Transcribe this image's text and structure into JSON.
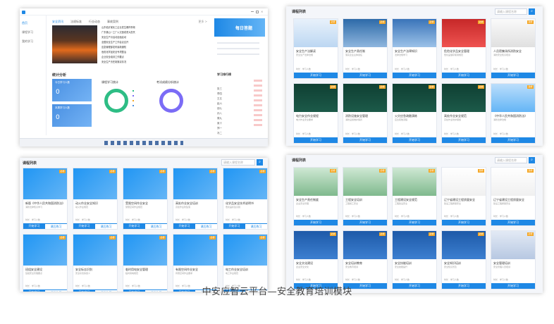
{
  "caption": "中安应智云平台—安全教育培训模块",
  "dashboard": {
    "sidebar": [
      "首页",
      "课程学习",
      "我的学习"
    ],
    "news_tabs": [
      "安全资讯",
      "法规标准",
      "行业动态",
      "事故案例"
    ],
    "more": "更多 >",
    "news_items": [
      "山东临沂某化工企业发生爆炸事故",
      "广东佛山一工厂火灾造成重大损失",
      "安全生产月活动全面启动",
      "全国安全生产工作会议召开",
      "应急管理部发布最新通知",
      "危险化学品安全专项整治",
      "企业安全培训工作要点",
      "安全生产责任制落实情况"
    ],
    "banner": "每日答题",
    "rank_title": "学习排行榜",
    "stats_title": "统计分析",
    "stat_tiles": [
      {
        "label": "今日学习人数",
        "value": "0"
      },
      {
        "label": "本周学习人数",
        "value": "0"
      }
    ],
    "donut1_title": "课程学习统计",
    "donut2_title": "考试成绩分析统计",
    "rank_list": [
      "张三",
      "李四",
      "王五",
      "赵六",
      "钱七",
      "孙八",
      "周九",
      "吴十",
      "郑一",
      "冯二"
    ],
    "bottom_card": "课程学习人数"
  },
  "panel_common": {
    "title": "课程列表",
    "search_placeholder": "请输入课程名称",
    "search_icon": "search-icon",
    "btn_start": "开始学习",
    "btn_review": "课后练习",
    "meta": "时长 · 学习人数"
  },
  "tr_cards": [
    {
      "name": "安全生产法解读",
      "desc": "安全生产法律法规",
      "badge": "必修"
    },
    {
      "name": "安全生产责任制",
      "desc": "落实企业主体责任",
      "badge": "必修"
    },
    {
      "name": "安全生产法律知识",
      "desc": "法律法规学习",
      "badge": "必修"
    },
    {
      "name": "危险化学品安全管理",
      "desc": "危化品储存使用规范",
      "badge": "必修"
    },
    {
      "name": "人员密集场所消防安全",
      "desc": "消防安全知识培训",
      "badge": "选修"
    },
    {
      "name": "电力安全作业规程",
      "desc": "电力作业安全要求",
      "badge": "必修"
    },
    {
      "name": "消防设施安全管理",
      "desc": "消防设施维护保养",
      "badge": "必修"
    },
    {
      "name": "火灾应急疏散演练",
      "desc": "应急疏散流程",
      "badge": "必修"
    },
    {
      "name": "高处作业安全规范",
      "desc": "高处作业防护措施",
      "badge": "必修"
    },
    {
      "name": "《中华人民共和国消防法》",
      "desc": "消防法律法规",
      "badge": "选修"
    }
  ],
  "bl_cards": [
    {
      "name": "新版《中华人民共和国消防法》",
      "desc": "消防法律知识学习",
      "badge": "必修"
    },
    {
      "name": "动火作业安全知识",
      "desc": "动火作业规范",
      "badge": "必修"
    },
    {
      "name": "受限空间作业安全",
      "desc": "受限空间作业规范",
      "badge": "必修"
    },
    {
      "name": "高处作业安全培训",
      "desc": "高处作业防坠落",
      "badge": "必修"
    },
    {
      "name": "化学品安全技术说明书",
      "desc": "危化品标签识别",
      "badge": "必修"
    },
    {
      "name": "班组安全建设",
      "desc": "班组安全管理要点",
      "badge": "必修"
    },
    {
      "name": "安全标志识别",
      "desc": "安全标志的含义",
      "badge": "必修"
    },
    {
      "name": "临时用电安全管理",
      "desc": "临时用电规范",
      "badge": "必修"
    },
    {
      "name": "有限空间作业安全",
      "desc": "有限空间作业要求",
      "badge": "必修"
    },
    {
      "name": "电工作业安全培训",
      "desc": "电工作业规范",
      "badge": "必修"
    }
  ],
  "br_cards": [
    {
      "name": "安全生产责任制度",
      "desc": "企业安全管理",
      "badge": "必修"
    },
    {
      "name": "工程安全培训",
      "desc": "工程施工安全",
      "badge": "必修"
    },
    {
      "name": "工程建设安全规范",
      "desc": "工程建设安全",
      "badge": "必修"
    },
    {
      "name": "辽宁省建设工程质量安全",
      "desc": "建设工程质量安全",
      "badge": "选修"
    },
    {
      "name": "辽宁省建设工程质量安全",
      "desc": "建设工程质量安全",
      "badge": "选修"
    },
    {
      "name": "安全文化建设",
      "desc": "企业安全文化",
      "badge": "必修"
    },
    {
      "name": "安全培训教育",
      "desc": "安全教育培训",
      "badge": "必修"
    },
    {
      "name": "安全技能培训",
      "desc": "安全技能提升",
      "badge": "必修"
    },
    {
      "name": "安全知识培训",
      "desc": "安全知识普及",
      "badge": "必修"
    },
    {
      "name": "安全管理培训",
      "desc": "安全管理人员培训",
      "badge": "必修"
    }
  ],
  "colors": {
    "accent": "#1e88e5",
    "badge_orange": "#f5a623",
    "tile_blue": "#4a90e2",
    "donut_green": "#2ebd85",
    "donut_purple": "#7b6cf6",
    "thumb_blue": "#2196f3",
    "thumb_dark": "#0d3b2e",
    "thumb_red": "#d32f2f"
  }
}
